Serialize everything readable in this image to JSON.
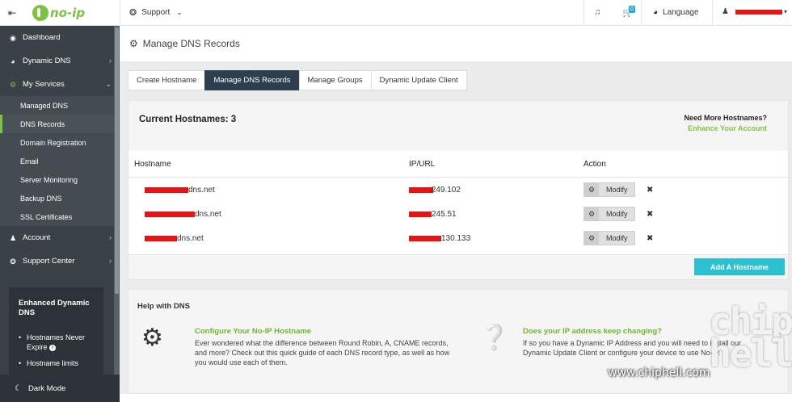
{
  "sidebar": {
    "logo_text": "no-ip",
    "nav": [
      {
        "label": "Dashboard",
        "icon": "dashboard-icon"
      },
      {
        "label": "Dynamic DNS",
        "icon": "globe-icon"
      },
      {
        "label": "My Services",
        "icon": "gear-icon"
      }
    ],
    "services": [
      "Managed DNS",
      "DNS Records",
      "Domain Registration",
      "Email",
      "Server Monitoring",
      "Backup DNS",
      "SSL Certificates"
    ],
    "nav_bottom": [
      {
        "label": "Account",
        "icon": "user-icon"
      },
      {
        "label": "Support Center",
        "icon": "lifebuoy-icon"
      }
    ],
    "promo": {
      "title": "Enhanced Dynamic DNS",
      "bullets": [
        "Hostnames Never Expire",
        "Hostname limits"
      ]
    },
    "dark_mode_label": "Dark Mode"
  },
  "topbar": {
    "support_label": "Support",
    "cart_count": "0",
    "language_label": "Language"
  },
  "page": {
    "title": "Manage DNS Records"
  },
  "tabs": [
    "Create Hostname",
    "Manage DNS Records",
    "Manage Groups",
    "Dynamic Update Client"
  ],
  "hostnames": {
    "count_label": "Current Hostnames: 3",
    "need_more": "Need More Hostnames?",
    "enhance_link": "Enhance Your Account",
    "headers": {
      "hostname": "Hostname",
      "ip": "IP/URL",
      "action": "Action"
    },
    "rows": [
      {
        "hostname": "dns.net",
        "ip": ".249.102"
      },
      {
        "hostname": "dns.net",
        "ip": "245.51"
      },
      {
        "hostname": "dns.net",
        "ip": "130.133"
      }
    ],
    "modify_label": "Modify",
    "delete_glyph": "✖",
    "add_button": "Add A Hostname"
  },
  "help": {
    "title": "Help with DNS",
    "items": [
      {
        "heading": "Configure Your No-IP Hostname",
        "text": "Ever wondered what the difference between Round Robin, A, CNAME records, and more? Check out this quick guide of each DNS record type, as well as how you would use each of them."
      },
      {
        "heading": "Does your IP address keep changing?",
        "text": "If so you have a Dynamic IP Address and you will need to install our Dynamic Update Client or configure your device to use No-IP."
      }
    ]
  },
  "watermark": {
    "big": "chip hell",
    "url": "www.chiphell.com"
  }
}
